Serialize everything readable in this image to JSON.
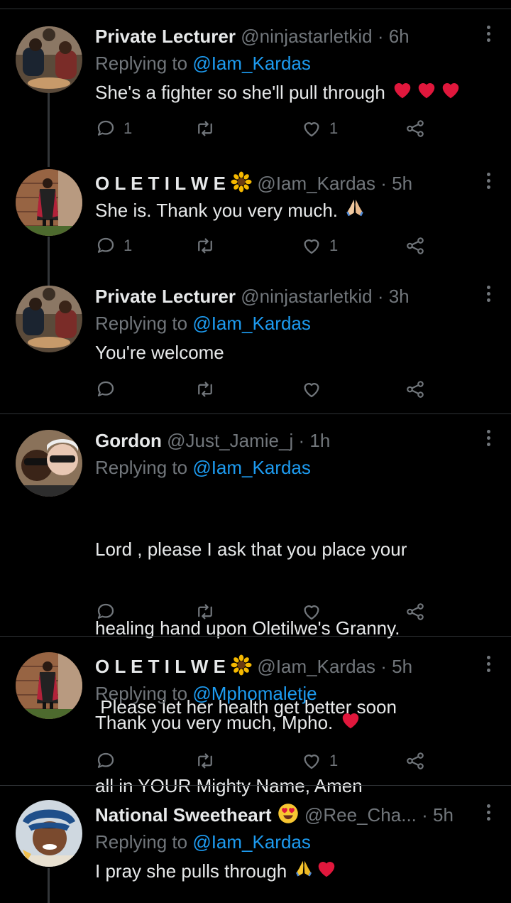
{
  "tweets": [
    {
      "name": "Private Lecturer",
      "handle": "@ninjastarletkid",
      "time": "· 6h",
      "replying_prefix": "Replying to ",
      "replying_to": "@Iam_Kardas",
      "text": "She's a fighter so she'll pull through",
      "emoji": "heart-x3",
      "replies": "1",
      "retweets": "",
      "likes": "1"
    },
    {
      "name": "O L E T I L W E",
      "handle": "@Iam_Kardas",
      "time": "· 5h",
      "text": "She is. Thank you very much.",
      "emoji": "folded-hands",
      "replies": "1",
      "retweets": "",
      "likes": "1"
    },
    {
      "name": "Private Lecturer",
      "handle": "@ninjastarletkid",
      "time": "· 3h",
      "replying_prefix": "Replying to ",
      "replying_to": "@Iam_Kardas",
      "text": "You're welcome",
      "replies": "",
      "retweets": "",
      "likes": ""
    },
    {
      "name": "Gordon",
      "handle": "@Just_Jamie_j",
      "time": "· 1h",
      "replying_prefix": "Replying to ",
      "replying_to": "@Iam_Kardas",
      "text_lines": [
        "Lord , please I ask that you place your",
        "healing hand upon Oletilwe's Granny.",
        " Please let her health get better soon",
        "all in YOUR Mighty Name, Amen"
      ],
      "replies": "",
      "retweets": "",
      "likes": ""
    },
    {
      "name": "O L E T I L W E",
      "handle": "@Iam_Kardas",
      "time": "· 5h",
      "replying_prefix": "Replying to ",
      "replying_to": "@Mphomaletje",
      "text": "Thank you very much, Mpho.",
      "emoji": "heart",
      "replies": "",
      "retweets": "",
      "likes": "1"
    },
    {
      "name": "National Sweetheart",
      "handle": "@Ree_Cha...",
      "time": "· 5h",
      "replying_prefix": "Replying to ",
      "replying_to": "@Iam_Kardas",
      "text": "I pray she pulls through",
      "emoji": "folded-hands-heart"
    }
  ],
  "colors": {
    "accent": "#1d9bf0",
    "heart": "#e0173c",
    "muted": "#71767b"
  },
  "icons": {
    "reply": "comment-icon",
    "retweet": "retweet-icon",
    "like": "heart-icon",
    "share": "share-icon",
    "more": "more-dots-icon"
  }
}
